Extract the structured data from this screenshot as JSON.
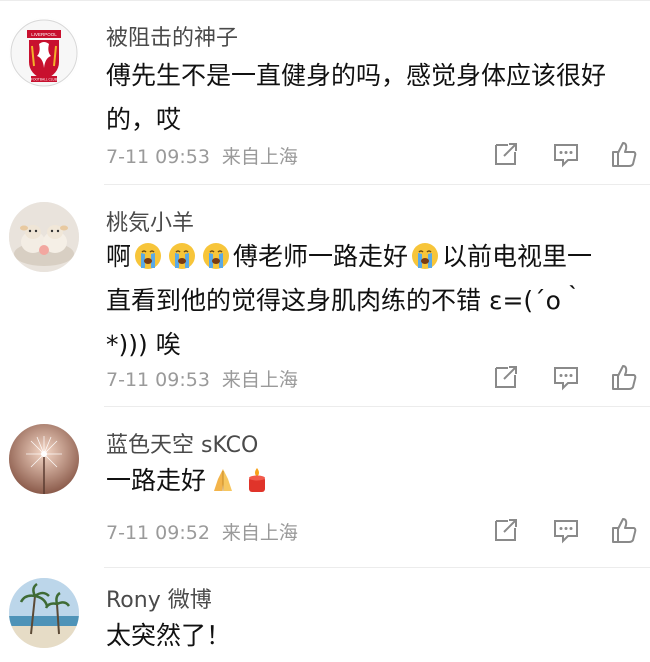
{
  "comments": [
    {
      "username": "被阻击的神子",
      "text_lines": [
        "傅先生不是一直健身的吗，感觉身体应该很好",
        "的，哎"
      ],
      "time": "7-11 09:53",
      "source": "来自上海",
      "avatar_icon": "liverpool-fc-crest",
      "avatar_text": [
        "LIVERPOOL",
        "FOOTBALL CLUB"
      ]
    },
    {
      "username": "桃気小羊",
      "line1_a": "啊",
      "line1_b": "傅老师一路走好",
      "line1_c": "以前电视里一",
      "line2": "直看到他的觉得这身肌肉练的不错 ε=(´ο｀",
      "line3": "*))) 唉",
      "time": "7-11 09:53",
      "source": "来自上海",
      "avatar_icon": "plush-sheep-photo",
      "emoji_icon": "loudly-crying-face-emoji"
    },
    {
      "username": "蓝色天空 sKCO",
      "text": "一路走好",
      "time": "7-11 09:52",
      "source": "来自上海",
      "avatar_icon": "dandelion-photo",
      "emoji_icons": [
        "folded-hands-emoji",
        "candle-emoji"
      ]
    },
    {
      "username": "Rony 微博",
      "text": "太突然了！",
      "avatar_icon": "beach-photo"
    }
  ],
  "action_icons": [
    "repost-icon",
    "comment-icon",
    "like-icon"
  ],
  "colors": {
    "username": "#4a4a4a",
    "meta": "#9a9a9a",
    "divider": "#ececec",
    "text": "#111111"
  }
}
